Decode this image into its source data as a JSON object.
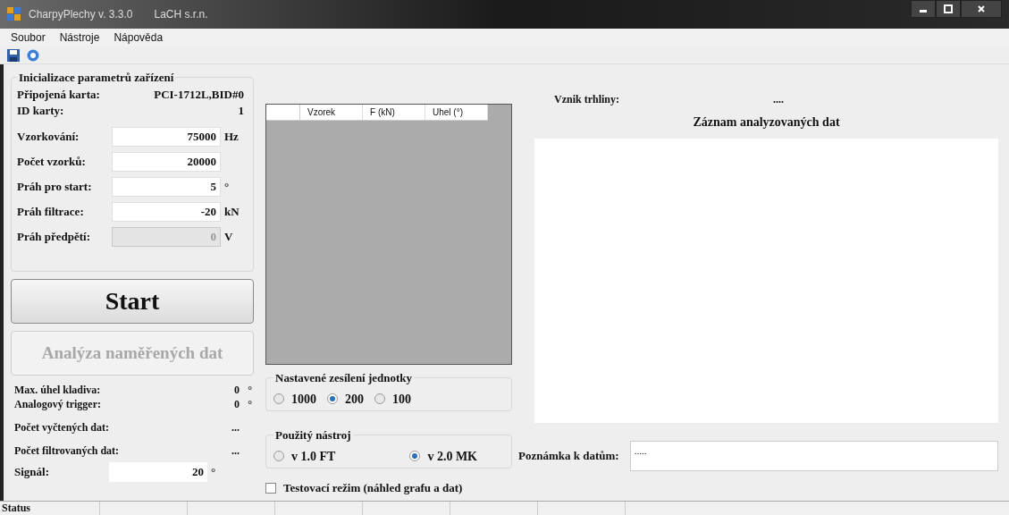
{
  "window": {
    "title": "CharpyPlechy  v. 3.3.0",
    "company": "LaCH s.r.n."
  },
  "menu": [
    "Soubor",
    "Nástroje",
    "Nápověda"
  ],
  "init_group": {
    "title": "Inicializace parametrů zařízení",
    "info": [
      {
        "label": "Připojená karta:",
        "value": "PCI-1712L,BID#0"
      },
      {
        "label": "ID karty:",
        "value": "1"
      }
    ],
    "fields": [
      {
        "label": "Vzorkování:",
        "value": "75000",
        "unit": "Hz",
        "disabled": false
      },
      {
        "label": "Počet vzorků:",
        "value": "20000",
        "disabled": false
      },
      {
        "label": "Práh pro start:",
        "value": "5",
        "unit": "°",
        "disabled": false
      },
      {
        "label": "Práh filtrace:",
        "value": "-20",
        "unit": "kN",
        "disabled": false
      },
      {
        "label": "Práh předpětí:",
        "value": "0",
        "unit": "V",
        "disabled": true
      }
    ]
  },
  "buttons": [
    {
      "label": "Start",
      "disabled": false
    },
    {
      "label": "Analýza naměřených dat",
      "disabled": true
    }
  ],
  "readouts": [
    {
      "label": "Max. úhel kladiva:",
      "value": "0",
      "unit": "°"
    },
    {
      "label": "Analogový trigger:",
      "value": "0",
      "unit": "°"
    },
    {
      "label": "Počet vyčtených dat:",
      "value": "..."
    },
    {
      "label": "Počet filtrovaných dat:",
      "value": "..."
    }
  ],
  "signal": {
    "label": "Signál:",
    "value": "20",
    "unit": "°"
  },
  "table": {
    "columns": [
      "Vzorek",
      "F (kN)",
      "Uhel (°)"
    ]
  },
  "gain_group": {
    "title": "Nastavené zesílení jednotky",
    "options": [
      {
        "label": "1000",
        "selected": false
      },
      {
        "label": "200",
        "selected": true
      },
      {
        "label": "100",
        "selected": false
      }
    ]
  },
  "tool_group": {
    "title": "Použitý nástroj",
    "options": [
      {
        "label": "v 1.0 FT",
        "selected": false
      },
      {
        "label": "v 2.0 MK",
        "selected": true
      }
    ]
  },
  "test_mode": {
    "label": "Testovací režim (náhled grafu a dat)",
    "checked": false
  },
  "crack": {
    "label": "Vznik trhliny:",
    "value": "...."
  },
  "log": {
    "title": "Záznam analyzovaných dat"
  },
  "note": {
    "label": "Poznámka k datům:",
    "value": "....."
  },
  "status_bar": [
    "Status"
  ]
}
